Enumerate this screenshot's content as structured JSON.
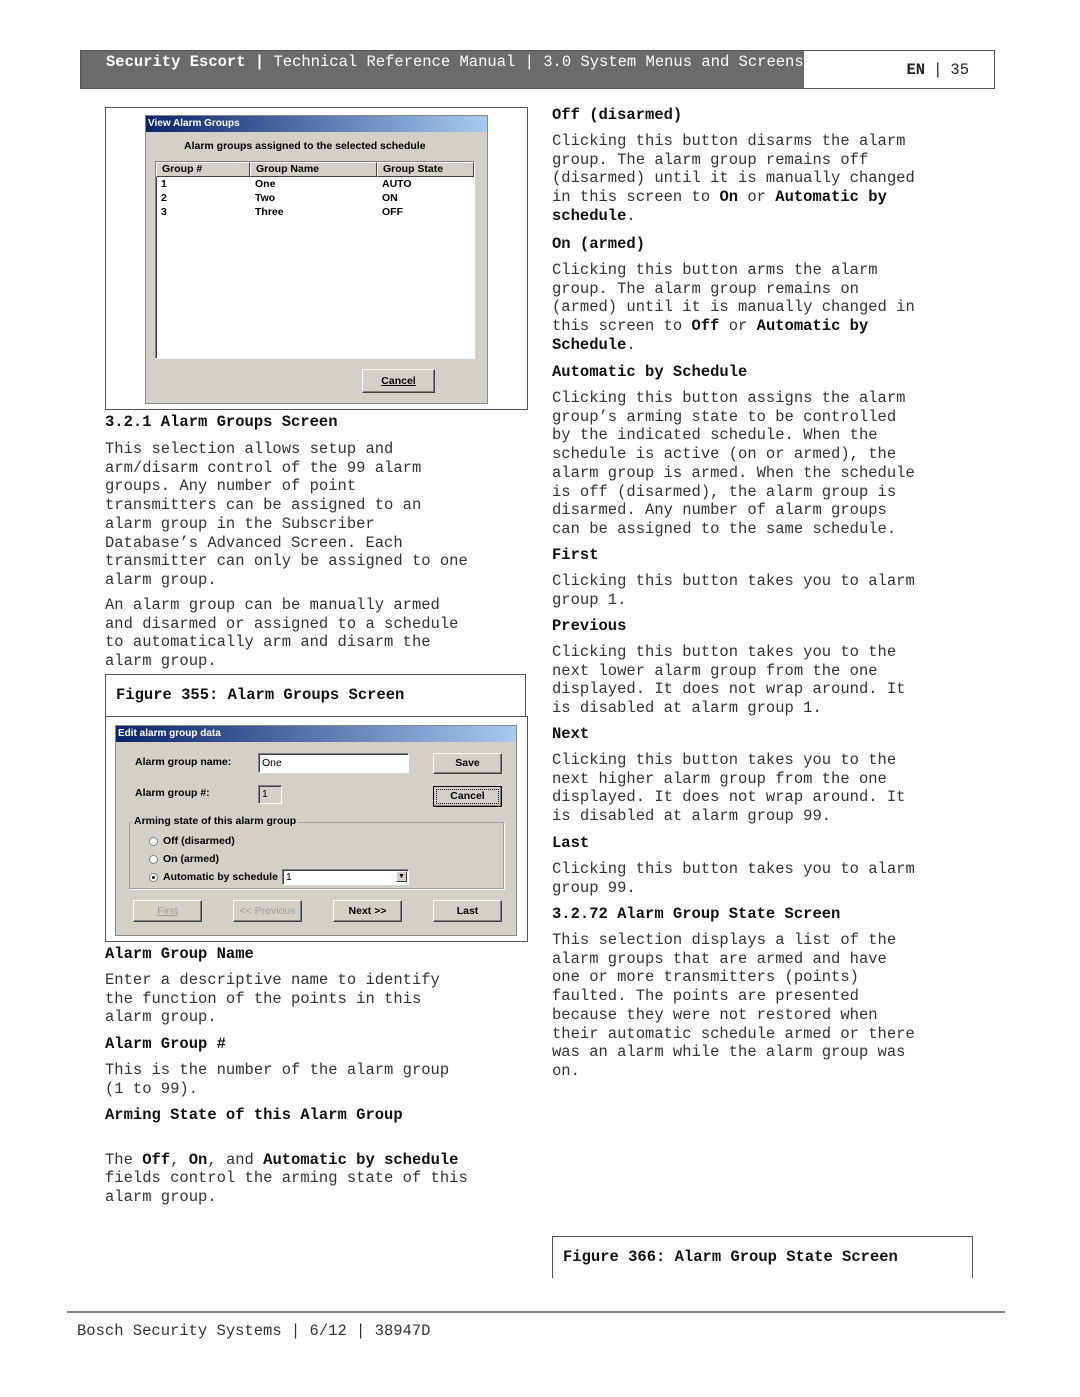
{
  "header": {
    "product": "Security Escort",
    "sep1": "|",
    "breadcrumb": "Technical Reference Manual | 3.0  System Menus and Screens",
    "lang": "EN",
    "sep2": "|",
    "page": "35"
  },
  "dialog_view": {
    "title": "View Alarm Groups",
    "subtitle": "Alarm groups assigned to the selected schedule",
    "columns": [
      "Group #",
      "Group Name",
      "Group State"
    ],
    "rows": [
      [
        "1",
        "One",
        "AUTO"
      ],
      [
        "2",
        "Two",
        "ON"
      ],
      [
        "3",
        "Three",
        "OFF"
      ]
    ],
    "cancel_label": "Cancel"
  },
  "section_321": {
    "heading": "3.2.1 Alarm Groups Screen",
    "para1": "This selection allows setup and\narm/disarm control of the 99 alarm\ngroups. Any number of point\ntransmitters can be assigned to an\nalarm group in the Subscriber\nDatabase’s Advanced Screen. Each\ntransmitter can only be assigned to one\nalarm group.",
    "para2": "An alarm group can be manually armed\nand disarmed or assigned to a schedule\nto automatically arm and disarm the\nalarm group.",
    "figure_caption": "Figure 355: Alarm Groups Screen"
  },
  "dialog_edit": {
    "title": "Edit alarm group data",
    "name_label": "Alarm group name:",
    "name_value": "One",
    "number_label": "Alarm group #:",
    "number_value": "1",
    "save_label": "Save",
    "cancel_label": "Cancel",
    "arming_legend": "Arming state of this alarm group",
    "radio_off": "Off (disarmed)",
    "radio_on": "On (armed)",
    "radio_auto": "Automatic by schedule",
    "selected_radio": "auto",
    "schedule_value": "1",
    "first_label": "First",
    "previous_label": "<< Previous",
    "next_label": "Next >>",
    "last_label": "Last"
  },
  "left_fields": {
    "name_heading": "Alarm Group Name",
    "name_text": "Enter a descriptive name to identify\nthe function of the points in this\nalarm group.",
    "number_heading": "Alarm Group #",
    "number_text": "This is the number of the alarm group\n(1 to 99).",
    "arming_heading": "Arming State of this Alarm Group",
    "arming_text_1": "The ",
    "arming_b1": "Off",
    "arming_text_2": ", ",
    "arming_b2": "On",
    "arming_text_3": ", and ",
    "arming_b3": "Automatic by schedule",
    "arming_text_4": "fields control the arming state of this\nalarm group."
  },
  "right_col": {
    "off_heading": "Off (disarmed)",
    "off_text_1": "Clicking this button disarms the alarm\ngroup. The alarm group remains off\n(disarmed) until it is manually changed\nin this screen to ",
    "off_b1": "On",
    "off_text_2": " or ",
    "off_b2": "Automatic by\nschedule",
    "off_text_3": ".",
    "on_heading": "On (armed)",
    "on_text_1": "Clicking this button arms the alarm\ngroup. The alarm group remains on\n(armed) until it is manually changed in\nthis screen to ",
    "on_b1": "Off",
    "on_text_2": " or ",
    "on_b2": "Automatic by\nSchedule",
    "on_text_3": ".",
    "auto_heading": "Automatic by Schedule",
    "auto_text": "Clicking this button assigns the alarm\ngroup’s arming state to be controlled\nby the indicated schedule. When the\nschedule is active (on or armed), the\nalarm group is armed. When the schedule\nis off (disarmed), the alarm group is\ndisarmed. Any number of alarm groups\ncan be assigned to the same schedule.",
    "first_heading": "First",
    "first_text": "Clicking this button takes you to alarm\ngroup 1.",
    "prev_heading": "Previous",
    "prev_text": "Clicking this button takes you to the\nnext lower alarm group from the one\ndisplayed. It does not wrap around. It\nis disabled at alarm group 1.",
    "next_heading": "Next",
    "next_text": "Clicking this button takes you to the\nnext higher alarm group from the one\ndisplayed. It does not wrap around. It\nis disabled at alarm group 99.",
    "last_heading": "Last",
    "last_text": "Clicking this button takes you to alarm\ngroup 99.",
    "state_heading": "3.2.72 Alarm Group State Screen",
    "state_text": "This selection displays a list of the\nalarm groups that are armed and have\none or more transmitters (points)\nfaulted. The points are presented\nbecause they were not restored when\ntheir automatic schedule armed or there\nwas an alarm while the alarm group was\non.",
    "figure_caption": "Figure 366: Alarm Group State Screen"
  },
  "footer": {
    "text": "Bosch Security Systems | 6/12 | 38947D"
  }
}
